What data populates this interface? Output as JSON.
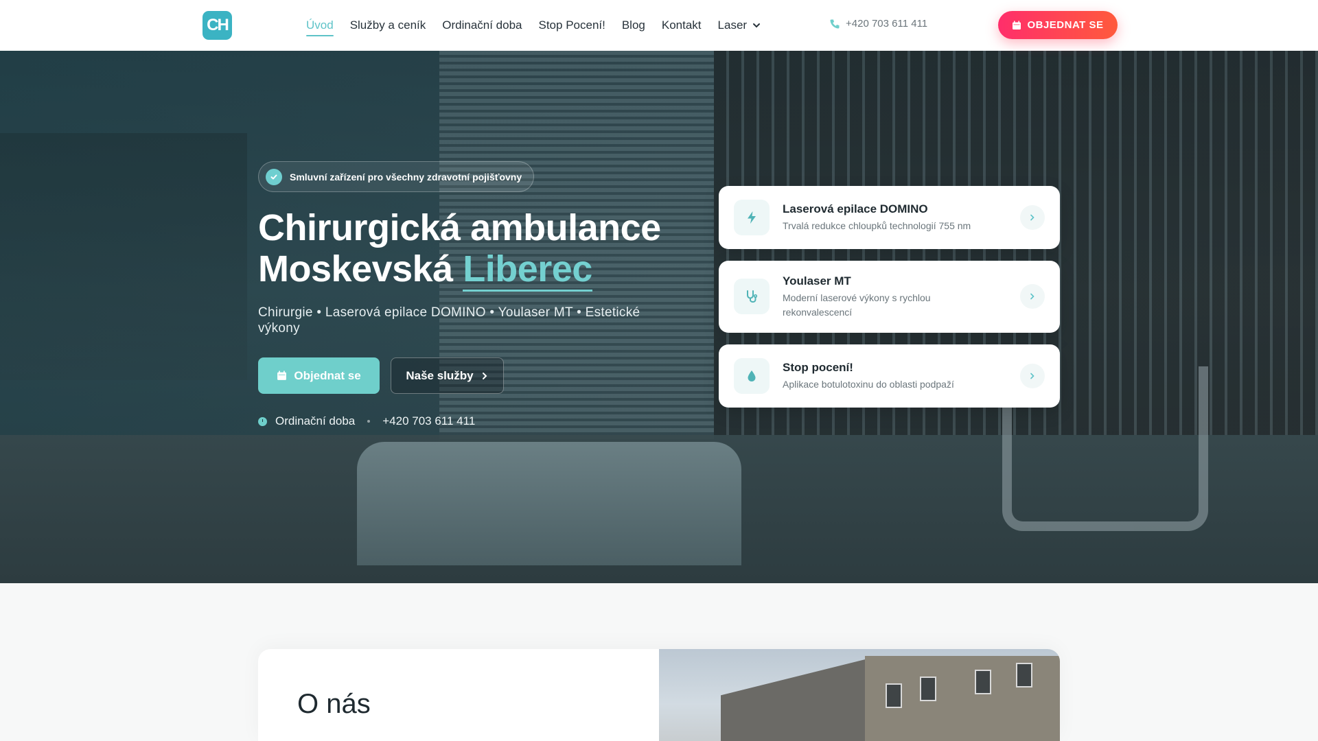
{
  "header": {
    "logo_text": "CH",
    "nav": [
      {
        "label": "Úvod",
        "active": true
      },
      {
        "label": "Služby a ceník",
        "active": false
      },
      {
        "label": "Ordinační doba",
        "active": false
      },
      {
        "label": "Stop Pocení!",
        "active": false
      },
      {
        "label": "Blog",
        "active": false
      },
      {
        "label": "Kontakt",
        "active": false
      },
      {
        "label": "Laser",
        "active": false,
        "dropdown": true
      }
    ],
    "phone": "+420 703 611 411",
    "cta_label": "OBJEDNAT SE"
  },
  "hero": {
    "badge": "Smluvní zařízení pro všechny zdravotní pojišťovny",
    "title_line1": "Chirurgická ambulance",
    "title_line2_plain": "Moskevská",
    "title_line2_accent": "Liberec",
    "subtitle": "Chirurgie • Laserová epilace DOMINO • Youlaser MT • Estetické výkony",
    "primary_button": "Objednat se",
    "secondary_button": "Naše služby",
    "hours_link": "Ordinační doba",
    "phone": "+420 703 611 411"
  },
  "cards": [
    {
      "title": "Laserová epilace DOMINO",
      "description": "Trvalá redukce chloupků technologií 755 nm",
      "icon": "bolt-icon"
    },
    {
      "title": "Youlaser MT",
      "description": "Moderní laserové výkony s rychlou rekonvalescencí",
      "icon": "stethoscope-icon"
    },
    {
      "title": "Stop pocení!",
      "description": "Aplikace botulotoxinu do oblasti podpaží",
      "icon": "droplet-icon"
    }
  ],
  "about": {
    "title": "O nás"
  },
  "colors": {
    "accent": "#6fcfcb",
    "cta_gradient_start": "#ff2e6b",
    "cta_gradient_end": "#ff5a3c"
  }
}
